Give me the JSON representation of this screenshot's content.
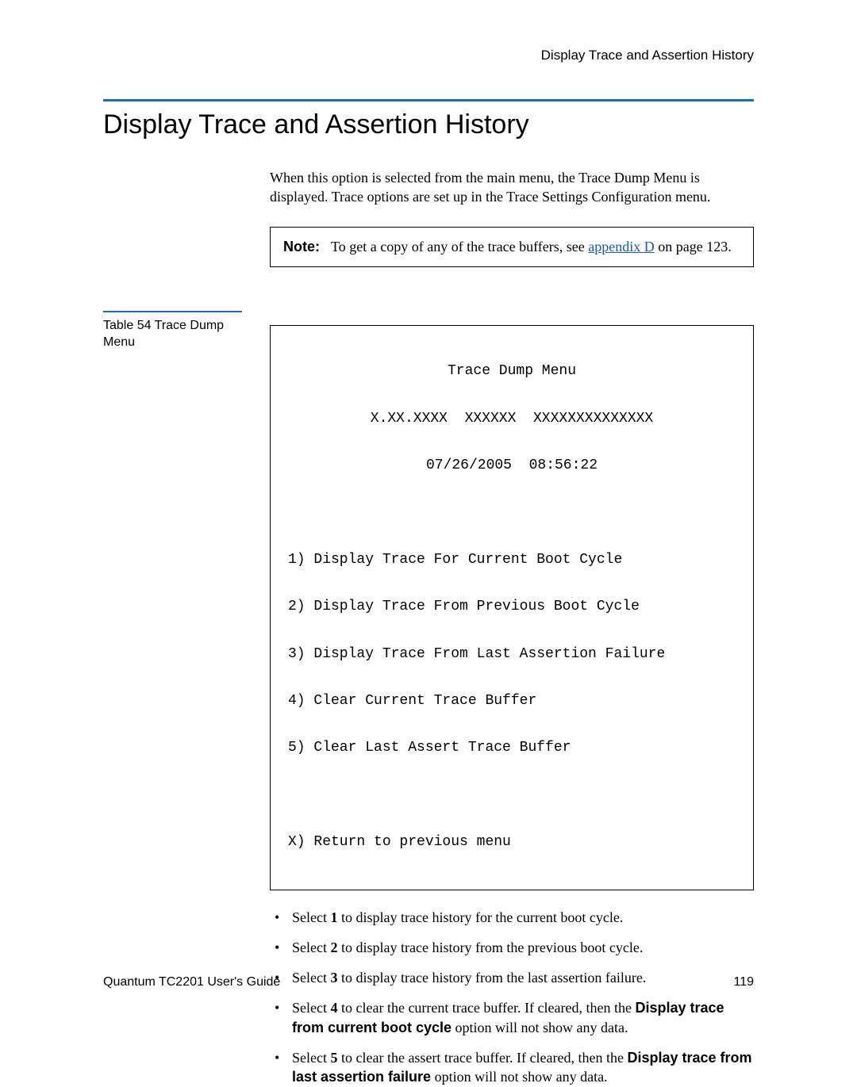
{
  "header": {
    "breadcrumb": "Display Trace and Assertion History"
  },
  "title": "Display Trace and Assertion History",
  "intro": "When this option is selected from the main menu, the Trace Dump Menu is displayed. Trace options are set up in the Trace Settings Configuration menu.",
  "note": {
    "label": "Note:",
    "prefix": "To get a copy of any of the trace buffers, see ",
    "link_text": "appendix D",
    "suffix": " on page 123."
  },
  "table_caption": "Table 54   Trace Dump Menu",
  "menu": {
    "title": "Trace Dump Menu",
    "version_line": "X.XX.XXXX  XXXXXX  XXXXXXXXXXXXXX",
    "timestamp": "07/26/2005  08:56:22",
    "items": [
      "1) Display Trace For Current Boot Cycle",
      "2) Display Trace From Previous Boot Cycle",
      "3) Display Trace From Last Assertion Failure",
      "4) Clear Current Trace Buffer",
      "5) Clear Last Assert Trace Buffer"
    ],
    "return_item": "X) Return to previous menu"
  },
  "bullets": {
    "b1_pre": "Select ",
    "b1_bold": "1",
    "b1_post": " to display trace history for the current boot cycle.",
    "b2_pre": "Select ",
    "b2_bold": "2",
    "b2_post": " to display trace history from the previous boot cycle.",
    "b3_pre": "Select ",
    "b3_bold": "3",
    "b3_post": " to display trace history from the last assertion failure.",
    "b4_pre": "Select ",
    "b4_bold": "4",
    "b4_post": " to clear the current trace buffer. If cleared, then the ",
    "b4_bold2": "Display trace from current boot cycle",
    "b4_post2": " option will not show any data.",
    "b5_pre": "Select ",
    "b5_bold": "5",
    "b5_post": " to clear the assert trace buffer. If cleared, then the ",
    "b5_bold2": "Display trace from last assertion failure",
    "b5_post2": " option will not show any data."
  },
  "footer": {
    "left": "Quantum TC2201 User's Guide",
    "right": "119"
  }
}
